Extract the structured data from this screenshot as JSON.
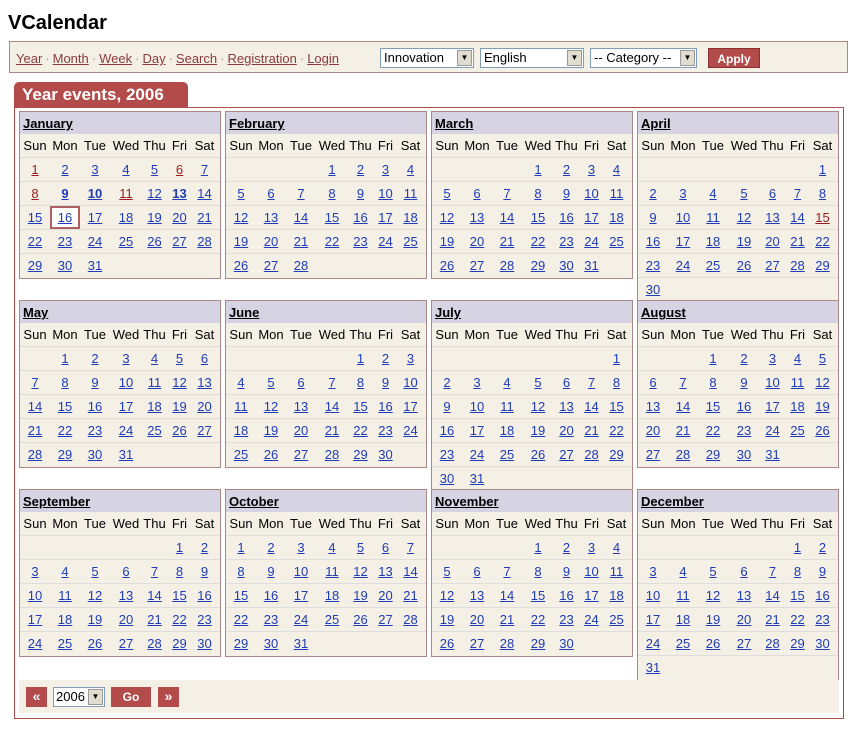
{
  "app": {
    "title": "VCalendar"
  },
  "nav": {
    "links": [
      "Year",
      "Month",
      "Week",
      "Day",
      "Search",
      "Registration",
      "Login"
    ],
    "separator": "·",
    "calendar_select": "Innovation",
    "language_select": "English",
    "category_select": "-- Category --",
    "apply_label": "Apply"
  },
  "header": {
    "title": "Year events, 2006"
  },
  "dow": [
    "Sun",
    "Mon",
    "Tue",
    "Wed",
    "Thu",
    "Fri",
    "Sat"
  ],
  "months": [
    {
      "name": "January",
      "weeks": [
        [
          1,
          2,
          3,
          4,
          5,
          6,
          7
        ],
        [
          8,
          9,
          10,
          11,
          12,
          13,
          14
        ],
        [
          15,
          16,
          17,
          18,
          19,
          20,
          21
        ],
        [
          22,
          23,
          24,
          25,
          26,
          27,
          28
        ],
        [
          29,
          30,
          31,
          null,
          null,
          null,
          null
        ]
      ],
      "holidays": [
        1,
        6,
        8,
        11
      ],
      "bold": [
        9,
        10,
        13
      ],
      "today": 16
    },
    {
      "name": "February",
      "weeks": [
        [
          null,
          null,
          null,
          1,
          2,
          3,
          4
        ],
        [
          5,
          6,
          7,
          8,
          9,
          10,
          11
        ],
        [
          12,
          13,
          14,
          15,
          16,
          17,
          18
        ],
        [
          19,
          20,
          21,
          22,
          23,
          24,
          25
        ],
        [
          26,
          27,
          28,
          null,
          null,
          null,
          null
        ]
      ],
      "holidays": [],
      "bold": []
    },
    {
      "name": "March",
      "weeks": [
        [
          null,
          null,
          null,
          1,
          2,
          3,
          4
        ],
        [
          5,
          6,
          7,
          8,
          9,
          10,
          11
        ],
        [
          12,
          13,
          14,
          15,
          16,
          17,
          18
        ],
        [
          19,
          20,
          21,
          22,
          23,
          24,
          25
        ],
        [
          26,
          27,
          28,
          29,
          30,
          31,
          null
        ]
      ],
      "holidays": [],
      "bold": []
    },
    {
      "name": "April",
      "weeks": [
        [
          null,
          null,
          null,
          null,
          null,
          null,
          1
        ],
        [
          2,
          3,
          4,
          5,
          6,
          7,
          8
        ],
        [
          9,
          10,
          11,
          12,
          13,
          14,
          15
        ],
        [
          16,
          17,
          18,
          19,
          20,
          21,
          22
        ],
        [
          23,
          24,
          25,
          26,
          27,
          28,
          29
        ],
        [
          30,
          null,
          null,
          null,
          null,
          null,
          null
        ]
      ],
      "holidays": [
        15
      ],
      "bold": []
    },
    {
      "name": "May",
      "weeks": [
        [
          null,
          1,
          2,
          3,
          4,
          5,
          6
        ],
        [
          7,
          8,
          9,
          10,
          11,
          12,
          13
        ],
        [
          14,
          15,
          16,
          17,
          18,
          19,
          20
        ],
        [
          21,
          22,
          23,
          24,
          25,
          26,
          27
        ],
        [
          28,
          29,
          30,
          31,
          null,
          null,
          null
        ]
      ],
      "holidays": [],
      "bold": []
    },
    {
      "name": "June",
      "weeks": [
        [
          null,
          null,
          null,
          null,
          1,
          2,
          3
        ],
        [
          4,
          5,
          6,
          7,
          8,
          9,
          10
        ],
        [
          11,
          12,
          13,
          14,
          15,
          16,
          17
        ],
        [
          18,
          19,
          20,
          21,
          22,
          23,
          24
        ],
        [
          25,
          26,
          27,
          28,
          29,
          30,
          null
        ]
      ],
      "holidays": [],
      "bold": []
    },
    {
      "name": "July",
      "weeks": [
        [
          null,
          null,
          null,
          null,
          null,
          null,
          1
        ],
        [
          2,
          3,
          4,
          5,
          6,
          7,
          8
        ],
        [
          9,
          10,
          11,
          12,
          13,
          14,
          15
        ],
        [
          16,
          17,
          18,
          19,
          20,
          21,
          22
        ],
        [
          23,
          24,
          25,
          26,
          27,
          28,
          29
        ],
        [
          30,
          31,
          null,
          null,
          null,
          null,
          null
        ]
      ],
      "holidays": [],
      "bold": []
    },
    {
      "name": "August",
      "weeks": [
        [
          null,
          null,
          1,
          2,
          3,
          4,
          5
        ],
        [
          6,
          7,
          8,
          9,
          10,
          11,
          12
        ],
        [
          13,
          14,
          15,
          16,
          17,
          18,
          19
        ],
        [
          20,
          21,
          22,
          23,
          24,
          25,
          26
        ],
        [
          27,
          28,
          29,
          30,
          31,
          null,
          null
        ]
      ],
      "holidays": [],
      "bold": []
    },
    {
      "name": "September",
      "weeks": [
        [
          null,
          null,
          null,
          null,
          null,
          1,
          2
        ],
        [
          3,
          4,
          5,
          6,
          7,
          8,
          9
        ],
        [
          10,
          11,
          12,
          13,
          14,
          15,
          16
        ],
        [
          17,
          18,
          19,
          20,
          21,
          22,
          23
        ],
        [
          24,
          25,
          26,
          27,
          28,
          29,
          30
        ]
      ],
      "holidays": [],
      "bold": []
    },
    {
      "name": "October",
      "weeks": [
        [
          1,
          2,
          3,
          4,
          5,
          6,
          7
        ],
        [
          8,
          9,
          10,
          11,
          12,
          13,
          14
        ],
        [
          15,
          16,
          17,
          18,
          19,
          20,
          21
        ],
        [
          22,
          23,
          24,
          25,
          26,
          27,
          28
        ],
        [
          29,
          30,
          31,
          null,
          null,
          null,
          null
        ]
      ],
      "holidays": [],
      "bold": []
    },
    {
      "name": "November",
      "weeks": [
        [
          null,
          null,
          null,
          1,
          2,
          3,
          4
        ],
        [
          5,
          6,
          7,
          8,
          9,
          10,
          11
        ],
        [
          12,
          13,
          14,
          15,
          16,
          17,
          18
        ],
        [
          19,
          20,
          21,
          22,
          23,
          24,
          25
        ],
        [
          26,
          27,
          28,
          29,
          30,
          null,
          null
        ]
      ],
      "holidays": [],
      "bold": []
    },
    {
      "name": "December",
      "weeks": [
        [
          null,
          null,
          null,
          null,
          null,
          1,
          2
        ],
        [
          3,
          4,
          5,
          6,
          7,
          8,
          9
        ],
        [
          10,
          11,
          12,
          13,
          14,
          15,
          16
        ],
        [
          17,
          18,
          19,
          20,
          21,
          22,
          23
        ],
        [
          24,
          25,
          26,
          27,
          28,
          29,
          30
        ],
        [
          31,
          null,
          null,
          null,
          null,
          null,
          null
        ]
      ],
      "holidays": [],
      "bold": []
    }
  ],
  "footer": {
    "prev_label": "«",
    "next_label": "»",
    "year_value": "2006",
    "go_label": "Go"
  }
}
